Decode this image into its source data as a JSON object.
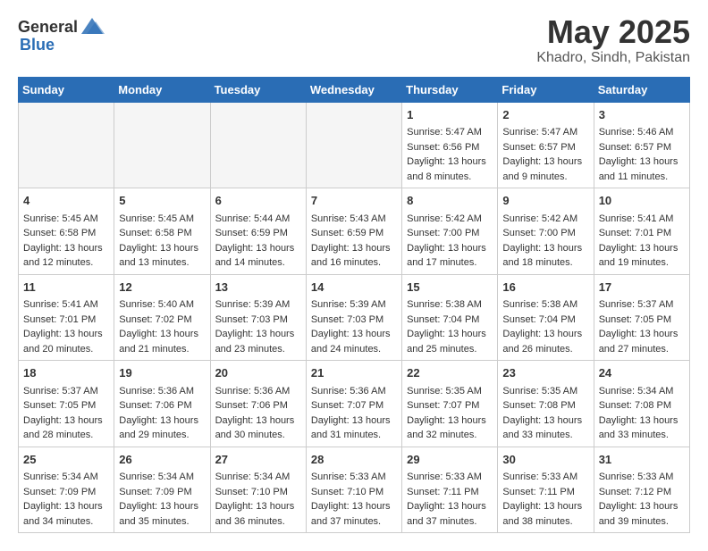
{
  "header": {
    "logo_general": "General",
    "logo_blue": "Blue",
    "title": "May 2025",
    "location": "Khadro, Sindh, Pakistan"
  },
  "days_of_week": [
    "Sunday",
    "Monday",
    "Tuesday",
    "Wednesday",
    "Thursday",
    "Friday",
    "Saturday"
  ],
  "weeks": [
    [
      {
        "day": "",
        "empty": true
      },
      {
        "day": "",
        "empty": true
      },
      {
        "day": "",
        "empty": true
      },
      {
        "day": "",
        "empty": true
      },
      {
        "day": "1",
        "sunrise": "5:47 AM",
        "sunset": "6:56 PM",
        "daylight": "13 hours and 8 minutes."
      },
      {
        "day": "2",
        "sunrise": "5:47 AM",
        "sunset": "6:57 PM",
        "daylight": "13 hours and 9 minutes."
      },
      {
        "day": "3",
        "sunrise": "5:46 AM",
        "sunset": "6:57 PM",
        "daylight": "13 hours and 11 minutes."
      }
    ],
    [
      {
        "day": "4",
        "sunrise": "5:45 AM",
        "sunset": "6:58 PM",
        "daylight": "13 hours and 12 minutes."
      },
      {
        "day": "5",
        "sunrise": "5:45 AM",
        "sunset": "6:58 PM",
        "daylight": "13 hours and 13 minutes."
      },
      {
        "day": "6",
        "sunrise": "5:44 AM",
        "sunset": "6:59 PM",
        "daylight": "13 hours and 14 minutes."
      },
      {
        "day": "7",
        "sunrise": "5:43 AM",
        "sunset": "6:59 PM",
        "daylight": "13 hours and 16 minutes."
      },
      {
        "day": "8",
        "sunrise": "5:42 AM",
        "sunset": "7:00 PM",
        "daylight": "13 hours and 17 minutes."
      },
      {
        "day": "9",
        "sunrise": "5:42 AM",
        "sunset": "7:00 PM",
        "daylight": "13 hours and 18 minutes."
      },
      {
        "day": "10",
        "sunrise": "5:41 AM",
        "sunset": "7:01 PM",
        "daylight": "13 hours and 19 minutes."
      }
    ],
    [
      {
        "day": "11",
        "sunrise": "5:41 AM",
        "sunset": "7:01 PM",
        "daylight": "13 hours and 20 minutes."
      },
      {
        "day": "12",
        "sunrise": "5:40 AM",
        "sunset": "7:02 PM",
        "daylight": "13 hours and 21 minutes."
      },
      {
        "day": "13",
        "sunrise": "5:39 AM",
        "sunset": "7:03 PM",
        "daylight": "13 hours and 23 minutes."
      },
      {
        "day": "14",
        "sunrise": "5:39 AM",
        "sunset": "7:03 PM",
        "daylight": "13 hours and 24 minutes."
      },
      {
        "day": "15",
        "sunrise": "5:38 AM",
        "sunset": "7:04 PM",
        "daylight": "13 hours and 25 minutes."
      },
      {
        "day": "16",
        "sunrise": "5:38 AM",
        "sunset": "7:04 PM",
        "daylight": "13 hours and 26 minutes."
      },
      {
        "day": "17",
        "sunrise": "5:37 AM",
        "sunset": "7:05 PM",
        "daylight": "13 hours and 27 minutes."
      }
    ],
    [
      {
        "day": "18",
        "sunrise": "5:37 AM",
        "sunset": "7:05 PM",
        "daylight": "13 hours and 28 minutes."
      },
      {
        "day": "19",
        "sunrise": "5:36 AM",
        "sunset": "7:06 PM",
        "daylight": "13 hours and 29 minutes."
      },
      {
        "day": "20",
        "sunrise": "5:36 AM",
        "sunset": "7:06 PM",
        "daylight": "13 hours and 30 minutes."
      },
      {
        "day": "21",
        "sunrise": "5:36 AM",
        "sunset": "7:07 PM",
        "daylight": "13 hours and 31 minutes."
      },
      {
        "day": "22",
        "sunrise": "5:35 AM",
        "sunset": "7:07 PM",
        "daylight": "13 hours and 32 minutes."
      },
      {
        "day": "23",
        "sunrise": "5:35 AM",
        "sunset": "7:08 PM",
        "daylight": "13 hours and 33 minutes."
      },
      {
        "day": "24",
        "sunrise": "5:34 AM",
        "sunset": "7:08 PM",
        "daylight": "13 hours and 33 minutes."
      }
    ],
    [
      {
        "day": "25",
        "sunrise": "5:34 AM",
        "sunset": "7:09 PM",
        "daylight": "13 hours and 34 minutes."
      },
      {
        "day": "26",
        "sunrise": "5:34 AM",
        "sunset": "7:09 PM",
        "daylight": "13 hours and 35 minutes."
      },
      {
        "day": "27",
        "sunrise": "5:34 AM",
        "sunset": "7:10 PM",
        "daylight": "13 hours and 36 minutes."
      },
      {
        "day": "28",
        "sunrise": "5:33 AM",
        "sunset": "7:10 PM",
        "daylight": "13 hours and 37 minutes."
      },
      {
        "day": "29",
        "sunrise": "5:33 AM",
        "sunset": "7:11 PM",
        "daylight": "13 hours and 37 minutes."
      },
      {
        "day": "30",
        "sunrise": "5:33 AM",
        "sunset": "7:11 PM",
        "daylight": "13 hours and 38 minutes."
      },
      {
        "day": "31",
        "sunrise": "5:33 AM",
        "sunset": "7:12 PM",
        "daylight": "13 hours and 39 minutes."
      }
    ]
  ]
}
